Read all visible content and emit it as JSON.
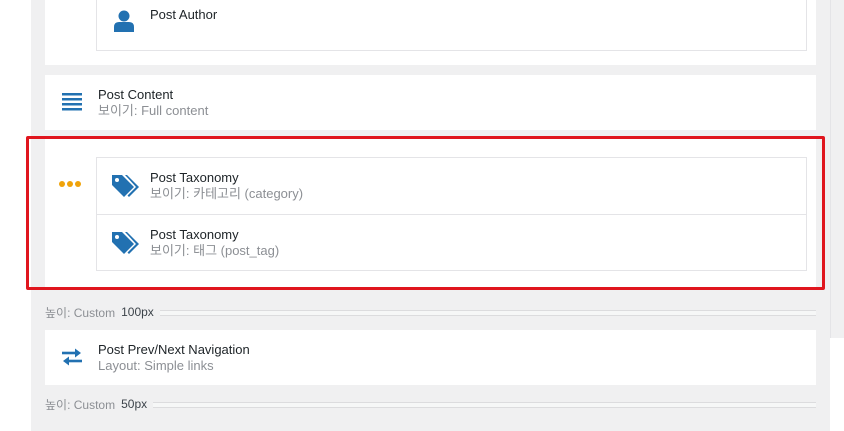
{
  "author_block": {
    "title": "Post Author"
  },
  "content_block": {
    "title": "Post Content",
    "subtitle": "보이기: Full content"
  },
  "taxonomy_block": {
    "items": [
      {
        "title": "Post Taxonomy",
        "subtitle": "보이기: 카테고리 (category)"
      },
      {
        "title": "Post Taxonomy",
        "subtitle": "보이기: 태그 (post_tag)"
      }
    ]
  },
  "height_rows": [
    {
      "label": "높이: Custom",
      "value": "100px"
    },
    {
      "label": "높이: Custom",
      "value": "50px"
    }
  ],
  "nav_block": {
    "title": "Post Prev/Next Navigation",
    "subtitle": "Layout: Simple links"
  },
  "colors": {
    "icon": "#2271b1",
    "accent_dots": "#f0a30a",
    "highlight": "#e0161e"
  },
  "icons": [
    "user-icon",
    "align-justify-icon",
    "ellipsis-icon",
    "tags-icon",
    "arrows-horizontal-icon"
  ]
}
